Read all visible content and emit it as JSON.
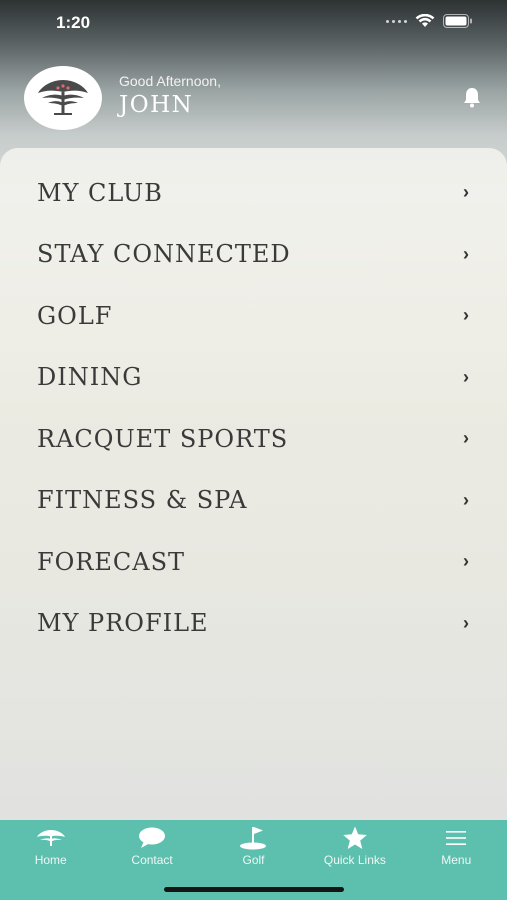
{
  "status_bar": {
    "time": "1:20"
  },
  "header": {
    "greeting": "Good Afternoon,",
    "username": "JOHN"
  },
  "menu": {
    "items": [
      {
        "label": "MY CLUB"
      },
      {
        "label": "STAY CONNECTED"
      },
      {
        "label": "GOLF"
      },
      {
        "label": "DINING"
      },
      {
        "label": "RACQUET SPORTS"
      },
      {
        "label": "FITNESS & SPA"
      },
      {
        "label": "FORECAST"
      },
      {
        "label": "MY PROFILE"
      }
    ],
    "chevron": "›"
  },
  "tab_bar": {
    "tabs": [
      {
        "label": "Home",
        "icon": "club-logo-icon"
      },
      {
        "label": "Contact",
        "icon": "chat-bubble-icon"
      },
      {
        "label": "Golf",
        "icon": "golf-flag-icon"
      },
      {
        "label": "Quick Links",
        "icon": "star-icon"
      },
      {
        "label": "Menu",
        "icon": "hamburger-menu-icon"
      }
    ]
  },
  "colors": {
    "tab_bar_bg": "#5dbfad",
    "menu_text": "#3a3a3a",
    "header_text": "#ffffff"
  }
}
